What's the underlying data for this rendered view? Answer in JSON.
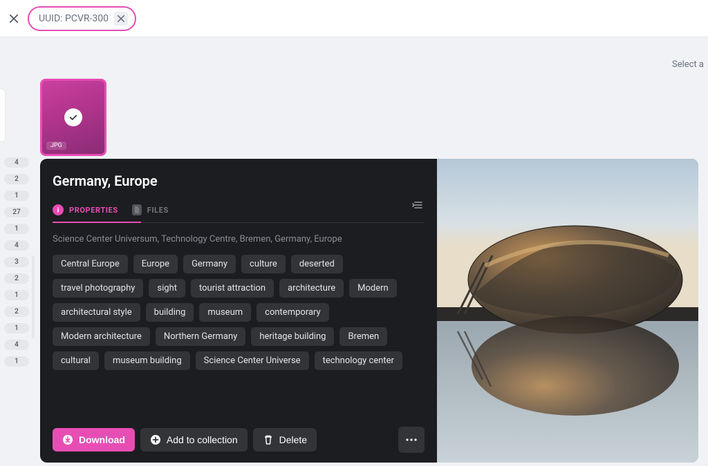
{
  "search": {
    "chip_text": "UUID: PCVR-300"
  },
  "header_hint": "Select a",
  "sidebar_counts": [
    "4",
    "2",
    "1",
    "27",
    "1",
    "4",
    "3",
    "2",
    "1",
    "2",
    "1",
    "4",
    "1"
  ],
  "thumbnail": {
    "format": "JPG"
  },
  "detail": {
    "title": "Germany, Europe",
    "tabs": {
      "properties": "PROPERTIES",
      "files": "FILES"
    },
    "description": "Science Center Universum, Technology Centre, Bremen, Germany, Europe",
    "tags": [
      "Central Europe",
      "Europe",
      "Germany",
      "culture",
      "deserted",
      "travel photography",
      "sight",
      "tourist attraction",
      "architecture",
      "Modern",
      "architectural style",
      "building",
      "museum",
      "contemporary",
      "Modern architecture",
      "Northern Germany",
      "heritage building",
      "Bremen",
      "cultural",
      "museum building",
      "Science Center Universe",
      "technology center"
    ],
    "actions": {
      "download": "Download",
      "add_collection": "Add to collection",
      "delete": "Delete"
    }
  }
}
